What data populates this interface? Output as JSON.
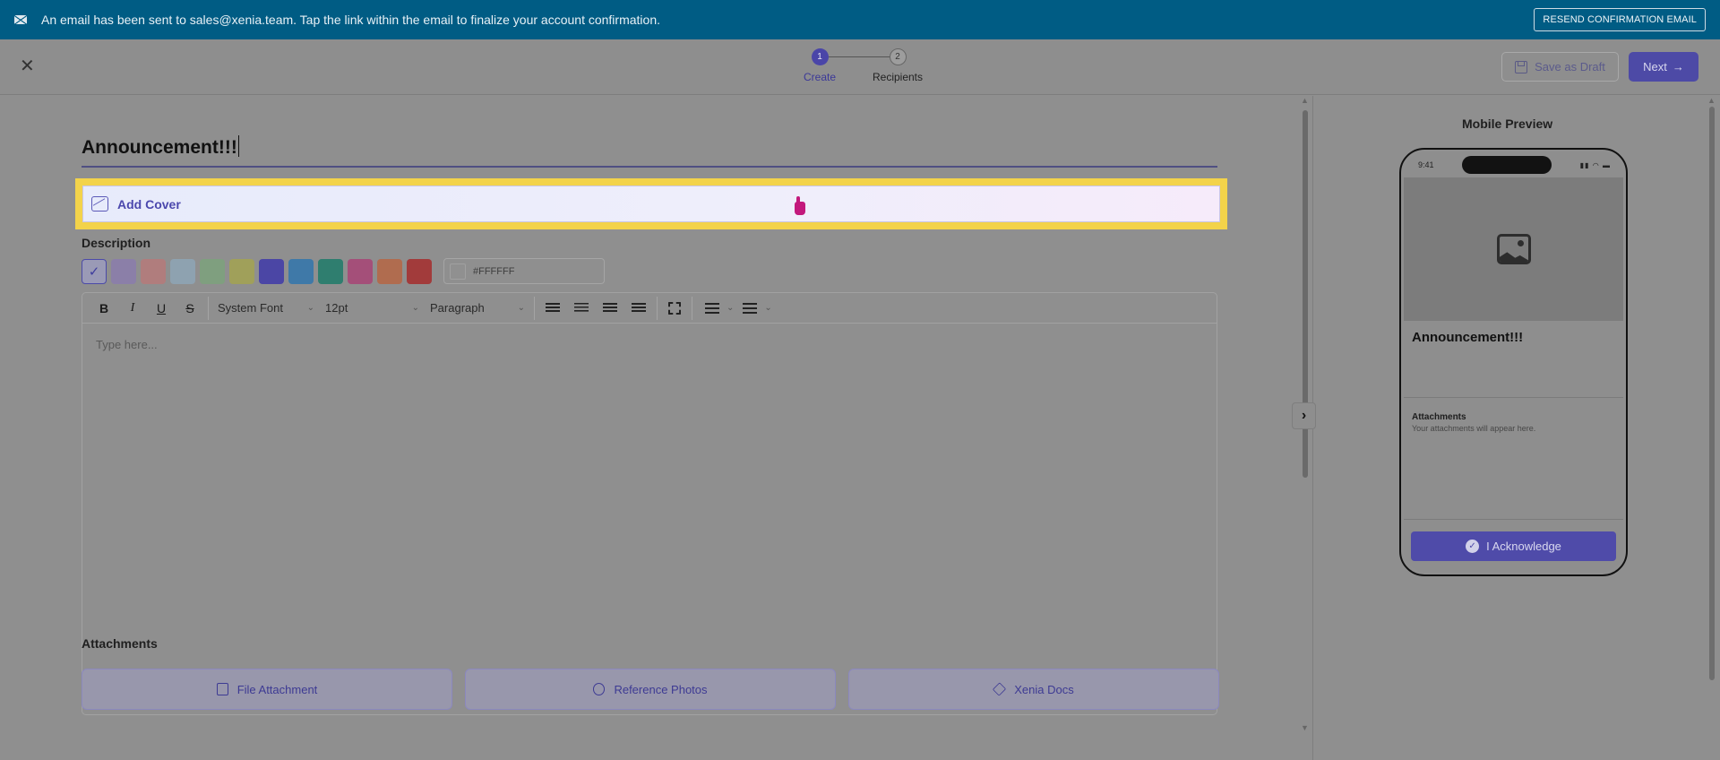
{
  "banner": {
    "message": "An email has been sent to sales@xenia.team. Tap the link within the email to finalize your account confirmation.",
    "resend_label": "RESEND CONFIRMATION EMAIL"
  },
  "header": {
    "steps": [
      {
        "number": "1",
        "label": "Create",
        "active": true
      },
      {
        "number": "2",
        "label": "Recipients",
        "active": false
      }
    ],
    "save_draft_label": "Save as Draft",
    "next_label": "Next"
  },
  "editor": {
    "title_value": "Announcement!!!",
    "add_cover_label": "Add Cover",
    "description_label": "Description",
    "swatch_colors": [
      "#9a9ab6",
      "#8b7fa8",
      "#b07d7d",
      "#8ea2b0",
      "#7f9f7f",
      "#a0a05a",
      "#4b46a5",
      "#3f79a8",
      "#2f7e6f",
      "#a44f79",
      "#b06c4f",
      "#a23b3b"
    ],
    "hex_value": "#FFFFFF",
    "toolbar": {
      "bold": "B",
      "italic": "I",
      "underline": "U",
      "strike": "S",
      "font_family": "System Font",
      "font_size": "12pt",
      "block_format": "Paragraph"
    },
    "body_placeholder": "Type here...",
    "attachments_label": "Attachments",
    "attachment_buttons": [
      "File Attachment",
      "Reference Photos",
      "Xenia Docs"
    ]
  },
  "preview": {
    "title": "Mobile Preview",
    "time": "9:41",
    "announcement_title": "Announcement!!!",
    "attachments_heading": "Attachments",
    "attachments_hint": "Your attachments will appear here.",
    "acknowledge_label": "I Acknowledge"
  },
  "colors": {
    "banner_bg": "#005c84",
    "accent": "#4d4aa6",
    "highlight": "#f3d34a"
  }
}
